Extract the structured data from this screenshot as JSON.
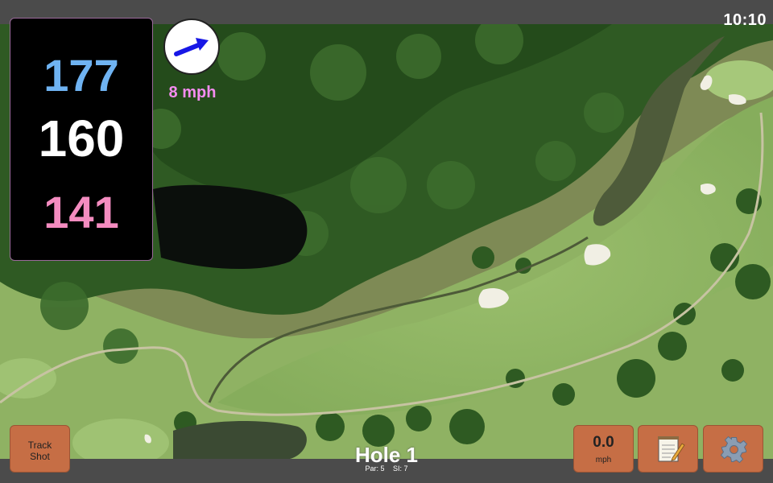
{
  "status": {
    "time": "10:10"
  },
  "distances": {
    "back": "177",
    "middle": "160",
    "front": "141"
  },
  "wind": {
    "speed": "8 mph",
    "direction_icon": "arrow-right-icon",
    "arrow_color": "#1717e6"
  },
  "buttons": {
    "track_shot_line1": "Track",
    "track_shot_line2": "Shot",
    "speed_value": "0.0",
    "speed_unit": "mph",
    "notes_icon": "notepad-icon",
    "settings_icon": "gear-icon"
  },
  "hole": {
    "title": "Hole 1",
    "par": "Par: 5",
    "si": "SI: 7"
  },
  "colors": {
    "back_distance": "#6fb3f2",
    "middle_distance": "#ffffff",
    "front_distance": "#f48cc0",
    "wind_text": "#f48cf0",
    "button_bg": "#c66e45"
  }
}
